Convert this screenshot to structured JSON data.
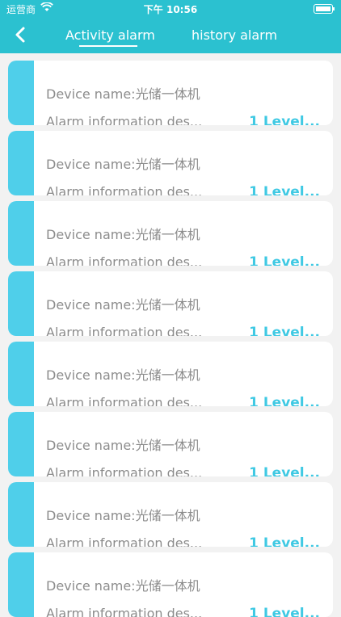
{
  "status_bar": {
    "carrier": "运营商",
    "time": "下午 10:56"
  },
  "nav": {
    "tabs": [
      {
        "label": "Activity alarm",
        "active": true
      },
      {
        "label": "history alarm",
        "active": false
      }
    ]
  },
  "alarms": [
    {
      "device": "Device name:光储一体机",
      "description": "Alarm information des...",
      "level": "1 Level..."
    },
    {
      "device": "Device name:光储一体机",
      "description": "Alarm information des...",
      "level": "1 Level..."
    },
    {
      "device": "Device name:光储一体机",
      "description": "Alarm information des...",
      "level": "1 Level..."
    },
    {
      "device": "Device name:光储一体机",
      "description": "Alarm information des...",
      "level": "1 Level..."
    },
    {
      "device": "Device name:光储一体机",
      "description": "Alarm information des...",
      "level": "1 Level..."
    },
    {
      "device": "Device name:光储一体机",
      "description": "Alarm information des...",
      "level": "1 Level..."
    },
    {
      "device": "Device name:光储一体机",
      "description": "Alarm information des...",
      "level": "1 Level..."
    },
    {
      "device": "Device name:光储一体机",
      "description": "Alarm information des...",
      "level": "1 Level..."
    }
  ],
  "colors": {
    "header": "#2bc1d0",
    "accent": "#4fcfea",
    "level_text": "#3fc9e3"
  }
}
